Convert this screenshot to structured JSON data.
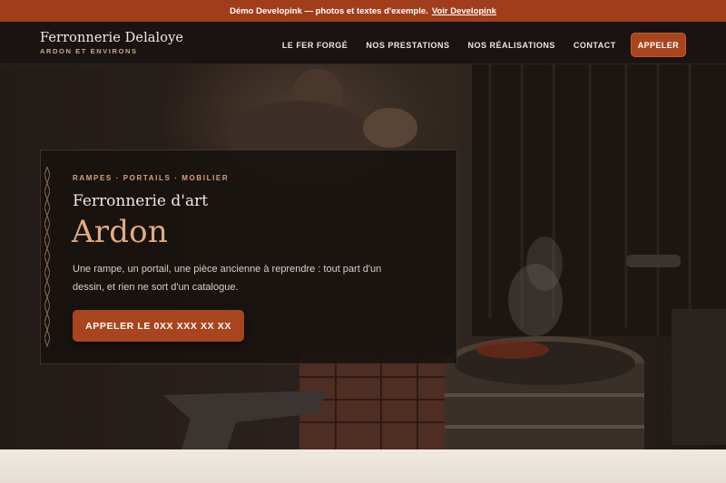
{
  "demo_banner": {
    "text": "Démo Developink — photos et textes d'exemple.",
    "link_label": "Voir Developink"
  },
  "header": {
    "brand_name": "Ferronnerie Delaloye",
    "brand_subtitle": "ARDON ET ENVIRONS",
    "nav": [
      {
        "label": "LE FER FORGÉ"
      },
      {
        "label": "NOS PRESTATIONS"
      },
      {
        "label": "NOS RÉALISATIONS"
      },
      {
        "label": "CONTACT"
      }
    ],
    "cta_label": "APPELER"
  },
  "hero": {
    "eyebrow": "RAMPES · PORTAILS · MOBILIER",
    "subtitle": "Ferronnerie d'art",
    "title": "Ardon",
    "description": "Une rampe, un portail, une pièce ancienne à reprendre : tout part d'un dessin, et rien ne sort d'un catalogue.",
    "call_button_label": "APPELER LE 0XX XXX XX XX"
  },
  "colors": {
    "accent": "#a8451f",
    "banner": "#a23d1c",
    "title_accent": "#e6ab7e",
    "eyebrow": "#d6a27c",
    "header_bg": "#191412"
  }
}
